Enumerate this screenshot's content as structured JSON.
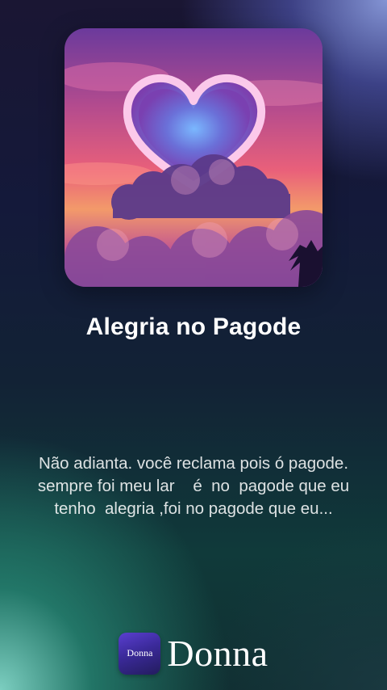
{
  "song": {
    "title": "Alegria no Pagode",
    "artwork_icon": "heart-cloud-artwork"
  },
  "lyrics": {
    "lines": [
      "Não adianta. você reclama pois ó pagode.",
      "sempre foi meu lar    é  no  pagode que eu",
      "tenho  alegria ,foi no pagode que eu..."
    ]
  },
  "brand": {
    "icon_text": "Donna",
    "name": "Donna",
    "accent": "#4b34b8"
  }
}
